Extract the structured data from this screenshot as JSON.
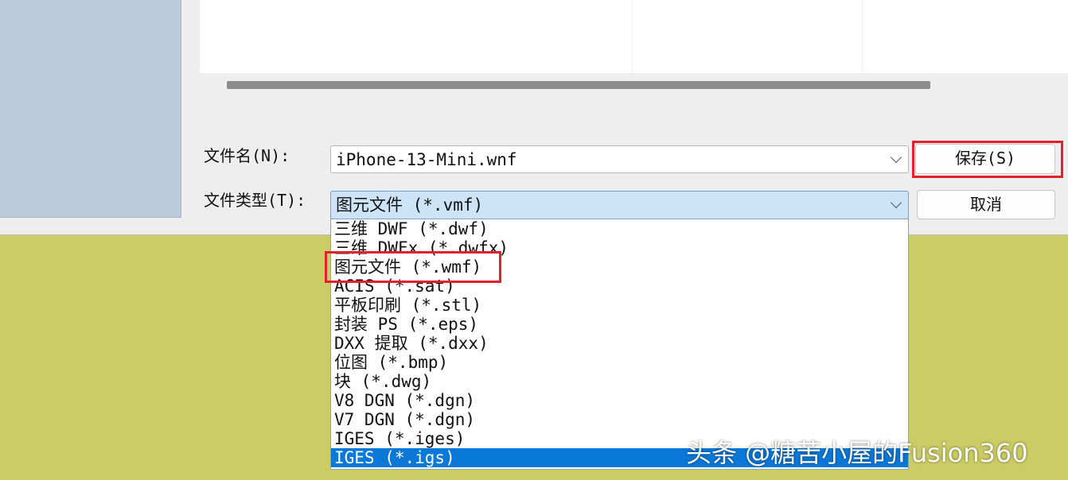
{
  "dialog": {
    "filename_label": "文件名(N):",
    "filename_value": "iPhone-13-Mini.wnf",
    "filetype_label": "文件类型(T):",
    "filetype_value": "图元文件 (*.vmf)",
    "save_button": "保存(S)",
    "cancel_button": "取消"
  },
  "filetype_options": [
    "三维 DWF (*.dwf)",
    "三维 DWFx (*.dwfx)",
    "图元文件 (*.wmf)",
    "ACIS (*.sat)",
    "平板印刷 (*.stl)",
    "封装 PS (*.eps)",
    "DXX 提取 (*.dxx)",
    "位图 (*.bmp)",
    "块 (*.dwg)",
    "V8 DGN (*.dgn)",
    "V7 DGN (*.dgn)",
    "IGES (*.iges)",
    "IGES (*.igs)"
  ],
  "selected_index": 12,
  "watermark": "头条 @糖苦小屋的Fusion360",
  "colors": {
    "highlight": "#e5202e",
    "selection": "#0a78d7",
    "background": "#cccc66"
  }
}
